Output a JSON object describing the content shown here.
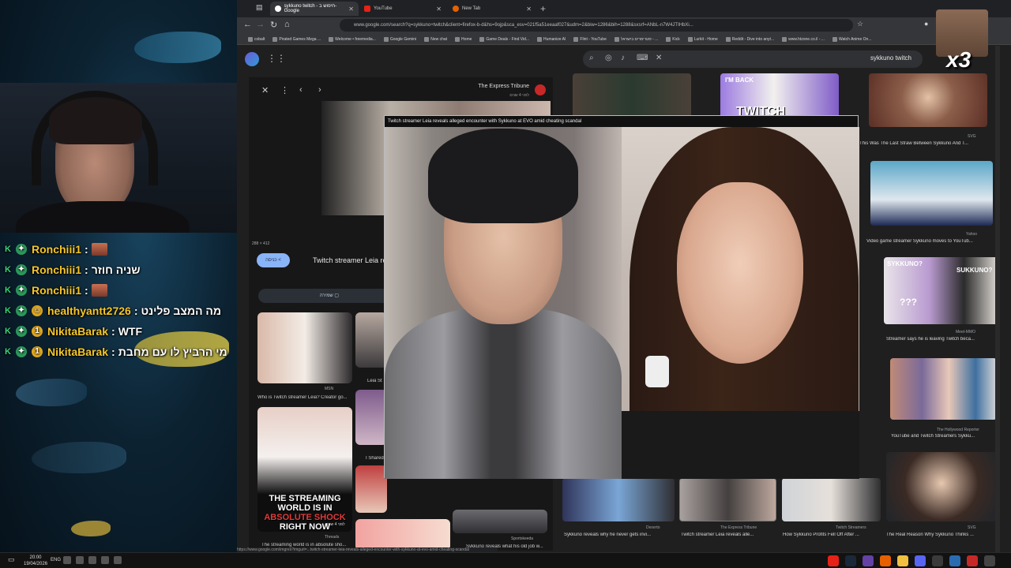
{
  "chat": {
    "lines": [
      {
        "user": "Ronchiii1",
        "sep": ":",
        "msg": ""
      },
      {
        "user": "Ronchiii1",
        "sep": ":",
        "msg": "שניה חוזר"
      },
      {
        "user": "Ronchiii1",
        "sep": ":",
        "msg": ""
      },
      {
        "user": "healthyantt2726",
        "sep": ":",
        "msg": "מה המצב פלינט"
      },
      {
        "user": "NikitaBarak",
        "sep": ":",
        "msg": "WTF"
      },
      {
        "user": "NikitaBarak",
        "sep": ":",
        "msg": "מי הרביץ לו עם מחבת"
      }
    ]
  },
  "emote_multiplier": "x3",
  "browser": {
    "tabs": [
      {
        "label": "sykkuno twitch - חיפוש ב-Google",
        "active": true
      },
      {
        "label": "YouTube",
        "active": false
      },
      {
        "label": "New Tab",
        "active": false
      }
    ],
    "url": "www.google.com/search?q=sykkuno+twitch&client=firefox-b-d&hs=9ojp&sca_esv=021f5a51eeaaf027&udm=2&biw=1286&bih=1288&sxsrf=ANbL-n7W4JTIHbXi...",
    "bookmarks": [
      "cobalt",
      "Pirated Games Mega ...",
      "Welcome • freemedia...",
      "Google Gemini",
      "New chat",
      "Home",
      "Game Deals - Find Vid...",
      "Humanize AI",
      "Flint - YouTube",
      "סטרימרים בישראל - ...",
      "Kick",
      "Lurkit - Home",
      "Reddit - Dive into anyt...",
      "www.htzone.co.il - ...",
      "Watch Anime On..."
    ]
  },
  "search": {
    "query": "sykkuno twitch"
  },
  "preview": {
    "source": "The Express Tribune",
    "time": "לפני 4 שנים",
    "dims": "288 × 412",
    "visit_label": "כניסה <",
    "title": "Twitch streamer Leia re",
    "save_label": "שמירה",
    "related": [
      {
        "source": "MSN",
        "caption": "Who is Twitch streamer Leia? Creator go..."
      },
      {
        "source": "",
        "caption": "Leia St"
      },
      {
        "source": "Threads",
        "caption": "The streaming world is in absolute sho..."
      },
      {
        "source": "",
        "caption": "I Shared"
      },
      {
        "source": "Sportskeeda",
        "caption": "Sykkuno reveals what his old job w..."
      }
    ],
    "overlay_text": [
      "THE STREAMING",
      "WORLD IS IN",
      "ABSOLUTE SHOCK",
      "RIGHT NOW"
    ],
    "overlay_time": "לפני 4 שנים"
  },
  "grid": [
    {
      "source": "SVG",
      "caption": "This Was The Last Straw Between Sykkuno And T..."
    },
    {
      "source": "Yahoo",
      "caption": "Video game streamer Sykkuno moves to YouTub..."
    },
    {
      "source": "Meet-MMO",
      "caption": "Streamer says he is leaving Twitch beca..."
    },
    {
      "source": "The Hollywood Reporter",
      "caption": "YouTube and Twitch Streamers Sykku..."
    },
    {
      "source": "Dexerto",
      "caption": "Sykkuno reveals why he never gets invi..."
    },
    {
      "source": "The Express Tribune",
      "caption": "Twitch streamer Leia reveals alle..."
    },
    {
      "source": "Twitch Streamers",
      "caption": "How Sykkuno Profits Fell Off After ..."
    },
    {
      "source": "SVG",
      "caption": "The Real Reason Why Sykkuno Thinks ..."
    }
  ],
  "grid_extra": {
    "twitch_word": "TWITCH",
    "im_back": "I'M BACK",
    "sykkuno_tag": "SYKKUNO?",
    "sykkuno_tag2": "SUKKUNO?",
    "qmarks": "???"
  },
  "popup": {
    "title": "Twitch streamer Leia reveals alleged encounter with Sykkuno at EVO amid cheating scandal"
  },
  "taskbar": {
    "time": "20:00",
    "date": "19/04/2026",
    "lang": "ENG"
  },
  "status_url": "https://www.google.com/imgres?imgurl=...twitch-streamer-leia-reveals-alleged-encounter-with-sykkuno-at-evo-amid-cheating-scandal"
}
